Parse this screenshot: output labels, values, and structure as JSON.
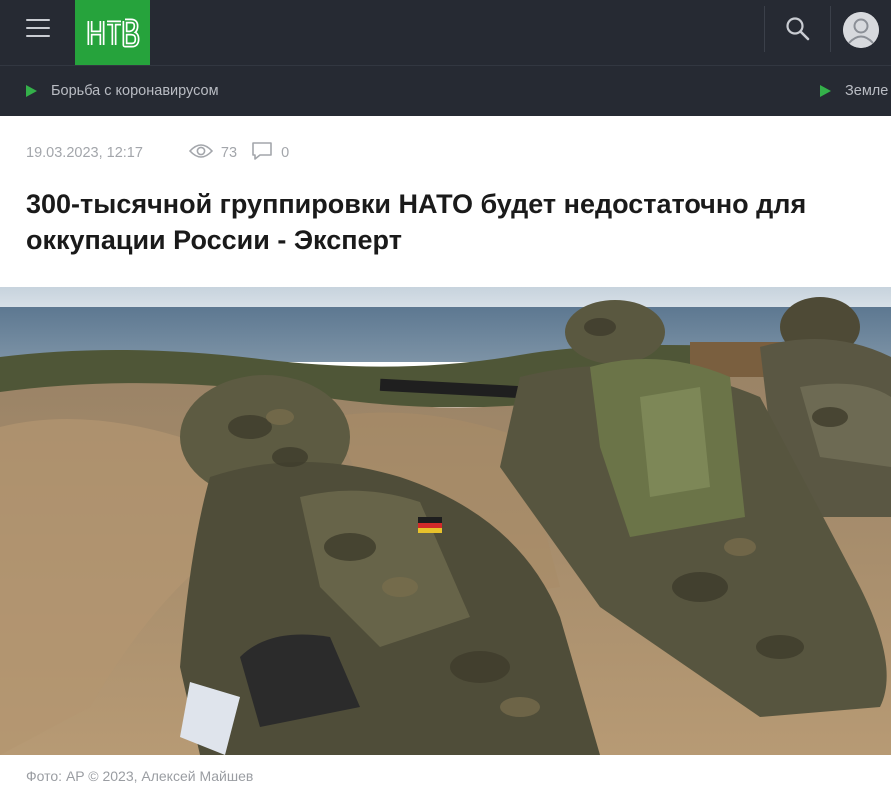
{
  "header": {
    "logo_text": "НТВ",
    "menu_icon": "hamburger-menu-icon",
    "search_icon": "search-icon",
    "user_icon": "user-avatar-icon"
  },
  "subnav": {
    "items": [
      {
        "label": "Борьба с коронавирусом"
      },
      {
        "label": "Земле"
      }
    ]
  },
  "article": {
    "date": "19.03.2023, 12:17",
    "views": "73",
    "comments": "0",
    "title": "300-тысячной группировки НАТО будет недостаточно для оккупации России - Эксперт",
    "photo_alt": "Солдаты в камуфляже на учениях",
    "caption": "Фото: AP © 2023, Алексей Майшев"
  },
  "colors": {
    "header_bg": "#262a33",
    "logo_green": "#26a33c",
    "accent_green": "#34b04a",
    "title_text": "#1a1a1a",
    "meta_text": "#a3a6ab"
  }
}
